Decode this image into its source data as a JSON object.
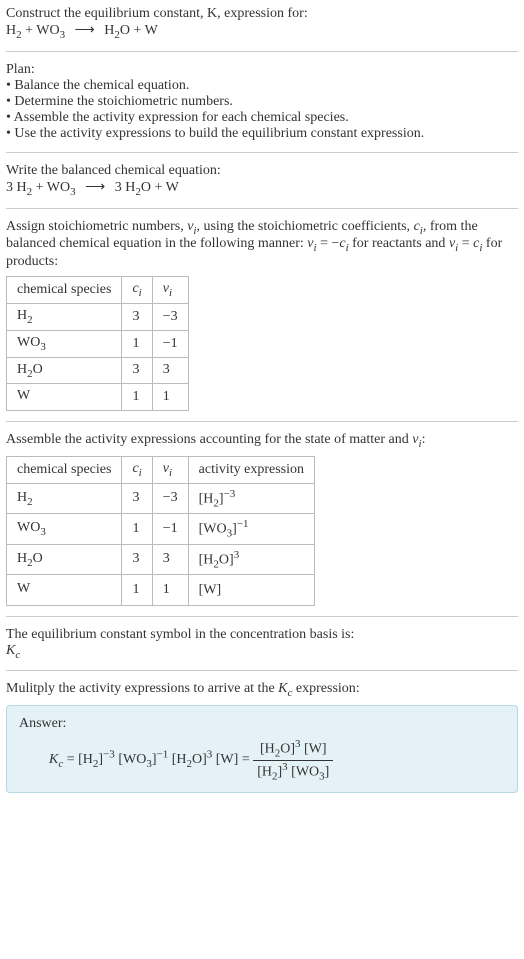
{
  "intro": {
    "line1": "Construct the equilibrium constant, K, expression for:",
    "eq_lhs1": "H",
    "eq_lhs1_sub": "2",
    "eq_plus": " + ",
    "eq_lhs2": "WO",
    "eq_lhs2_sub": "3",
    "arrow": "⟶",
    "eq_rhs1": "H",
    "eq_rhs1_sub": "2",
    "eq_rhs1_tail": "O",
    "eq_rhs2": "W"
  },
  "plan": {
    "title": "Plan:",
    "items": [
      "• Balance the chemical equation.",
      "• Determine the stoichiometric numbers.",
      "• Assemble the activity expression for each chemical species.",
      "• Use the activity expressions to build the equilibrium constant expression."
    ]
  },
  "balanced": {
    "title": "Write the balanced chemical equation:",
    "c1": "3 ",
    "s1": "H",
    "s1sub": "2",
    "plus1": " + ",
    "s2": "WO",
    "s2sub": "3",
    "arrow": "⟶",
    "c3": "3 ",
    "s3": "H",
    "s3sub": "2",
    "s3tail": "O",
    "plus2": " + ",
    "s4": "W"
  },
  "stoich": {
    "title_a": "Assign stoichiometric numbers, ",
    "nu": "ν",
    "nu_sub": "i",
    "title_b": ", using the stoichiometric coefficients, ",
    "c": "c",
    "c_sub": "i",
    "title_c": ", from the balanced chemical equation in the following manner: ",
    "rel1a": "ν",
    "rel1b": "i",
    "rel1c": " = −",
    "rel1d": "c",
    "rel1e": "i",
    "title_d": " for reactants and ",
    "rel2a": "ν",
    "rel2b": "i",
    "rel2c": " = ",
    "rel2d": "c",
    "rel2e": "i",
    "title_e": " for products:",
    "headers": [
      "chemical species",
      "c_i",
      "ν_i"
    ],
    "rows": [
      {
        "sp": "H",
        "spsub": "2",
        "sptail": "",
        "c": "3",
        "nu": "−3"
      },
      {
        "sp": "WO",
        "spsub": "3",
        "sptail": "",
        "c": "1",
        "nu": "−1"
      },
      {
        "sp": "H",
        "spsub": "2",
        "sptail": "O",
        "c": "3",
        "nu": "3"
      },
      {
        "sp": "W",
        "spsub": "",
        "sptail": "",
        "c": "1",
        "nu": "1"
      }
    ]
  },
  "activity": {
    "title_a": "Assemble the activity expressions accounting for the state of matter and ",
    "nu": "ν",
    "nu_sub": "i",
    "title_b": ":",
    "headers": [
      "chemical species",
      "c_i",
      "ν_i",
      "activity expression"
    ],
    "rows": [
      {
        "sp": "H",
        "spsub": "2",
        "sptail": "",
        "c": "3",
        "nu": "−3",
        "ae_pre": "[H",
        "ae_sub": "2",
        "ae_post": "]",
        "ae_exp": "−3"
      },
      {
        "sp": "WO",
        "spsub": "3",
        "sptail": "",
        "c": "1",
        "nu": "−1",
        "ae_pre": "[WO",
        "ae_sub": "3",
        "ae_post": "]",
        "ae_exp": "−1"
      },
      {
        "sp": "H",
        "spsub": "2",
        "sptail": "O",
        "c": "3",
        "nu": "3",
        "ae_pre": "[H",
        "ae_sub": "2",
        "ae_post": "O]",
        "ae_exp": "3"
      },
      {
        "sp": "W",
        "spsub": "",
        "sptail": "",
        "c": "1",
        "nu": "1",
        "ae_pre": "[W]",
        "ae_sub": "",
        "ae_post": "",
        "ae_exp": ""
      }
    ]
  },
  "kcsym": {
    "title": "The equilibrium constant symbol in the concentration basis is:",
    "K": "K",
    "Ksub": "c"
  },
  "final": {
    "title_a": "Mulitply the activity expressions to arrive at the ",
    "K": "K",
    "Ksub": "c",
    "title_b": " expression:",
    "answer": "Answer:",
    "eq_K": "K",
    "eq_Ksub": "c",
    "eq_eq": " = ",
    "t1_pre": "[H",
    "t1_sub": "2",
    "t1_post": "]",
    "t1_exp": "−3",
    "sp": " ",
    "t2_pre": "[WO",
    "t2_sub": "3",
    "t2_post": "]",
    "t2_exp": "−1",
    "t3_pre": "[H",
    "t3_sub": "2",
    "t3_post": "O]",
    "t3_exp": "3",
    "t4": "[W]",
    "eq2": " = ",
    "num_a_pre": "[H",
    "num_a_sub": "2",
    "num_a_post": "O]",
    "num_a_exp": "3",
    "num_b": "[W]",
    "den_a_pre": "[H",
    "den_a_sub": "2",
    "den_a_post": "]",
    "den_a_exp": "3",
    "den_b_pre": "[WO",
    "den_b_sub": "3",
    "den_b_post": "]"
  }
}
